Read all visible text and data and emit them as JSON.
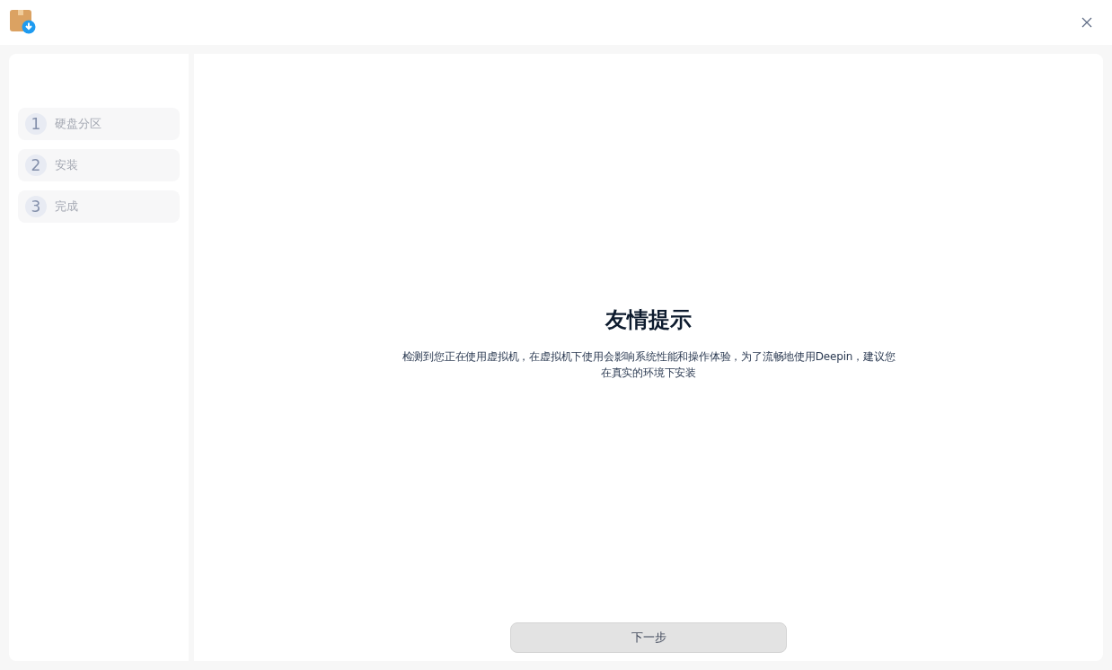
{
  "steps": [
    {
      "number": "1",
      "label": "硬盘分区",
      "selected": false
    },
    {
      "number": "2",
      "label": "安装",
      "selected": false
    },
    {
      "number": "3",
      "label": "完成",
      "selected": false
    }
  ],
  "notice": {
    "title": "友情提示",
    "message": "检测到您正在使用虚拟机，在虚拟机下使用会影响系统性能和操作体验，为了流畅地使用Deepin，建议您在真实的环境下安装"
  },
  "next_button": "下一步"
}
